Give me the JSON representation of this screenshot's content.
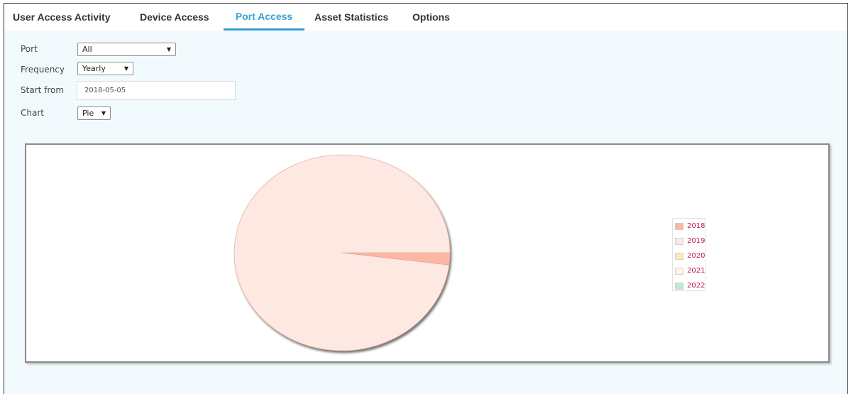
{
  "tabs": [
    {
      "label": "User Access Activity"
    },
    {
      "label": "Device Access"
    },
    {
      "label": "Port Access"
    },
    {
      "label": "Asset Statistics"
    },
    {
      "label": "Options"
    }
  ],
  "active_tab": "Port Access",
  "form": {
    "port_label": "Port",
    "port_value": "All",
    "frequency_label": "Frequency",
    "frequency_value": "Yearly",
    "start_label": "Start from",
    "start_value": "2018-05-05",
    "chart_label": "Chart",
    "chart_value": "Pie"
  },
  "colors": {
    "accent": "#3a9fd6",
    "background": "#f3fafd",
    "legend_text": "#c2185b"
  },
  "chart_data": {
    "type": "pie",
    "title": "",
    "categories": [
      "2018",
      "2019",
      "2020",
      "2021",
      "2022"
    ],
    "values": [
      2,
      98,
      0,
      0,
      0
    ],
    "colors": [
      "#fbb7a3",
      "#fde8e2",
      "#fde9b3",
      "#fdf4e5",
      "#b7edd2"
    ],
    "legend": [
      "2018",
      "2019",
      "2020",
      "2021",
      "2022"
    ],
    "legend_position": "right"
  }
}
